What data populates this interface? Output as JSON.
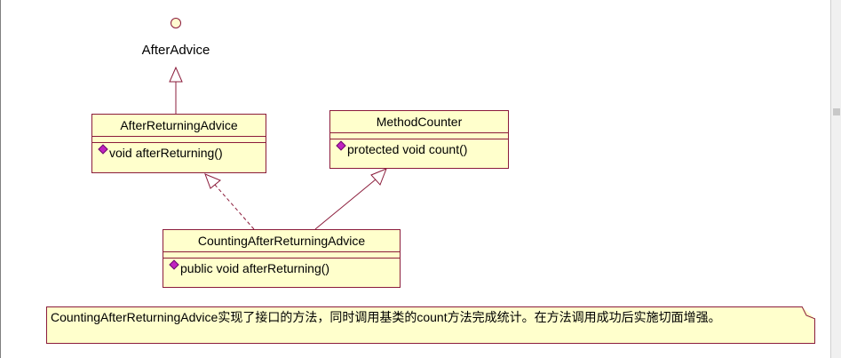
{
  "interface": {
    "name": "AfterAdvice"
  },
  "classes": {
    "after_returning_advice": {
      "name": "AfterReturningAdvice",
      "operation": "void afterReturning()"
    },
    "method_counter": {
      "name": "MethodCounter",
      "operation": "protected void count()"
    },
    "counting_after_returning_advice": {
      "name": "CountingAfterReturningAdvice",
      "operation": "public void afterReturning()"
    }
  },
  "note": {
    "text": "CountingAfterReturningAdvice实现了接口的方法，同时调用基类的count方法完成统计。在方法调用成功后实施切面增强。"
  },
  "colors": {
    "border": "#8b1c3b",
    "fill": "#ffffcc",
    "operation_icon": "#c023c0"
  }
}
